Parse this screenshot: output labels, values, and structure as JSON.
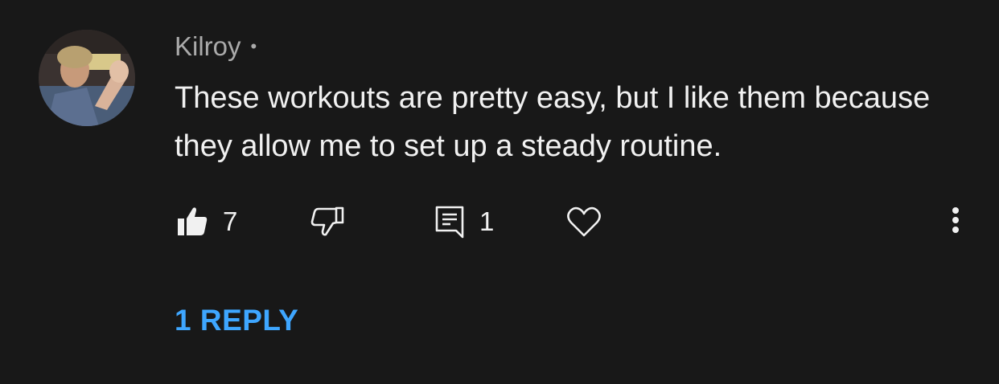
{
  "comment": {
    "author": "Kilroy",
    "separator": "•",
    "text": "These workouts are pretty easy, but I like them because they allow me to set up a steady routine.",
    "like_count": "7",
    "reply_count": "1",
    "replies_link": "1 REPLY"
  },
  "icons": {
    "like": "thumbs-up-filled-icon",
    "dislike": "thumbs-down-outline-icon",
    "reply": "comment-icon",
    "heart": "heart-outline-icon",
    "more": "more-vertical-icon"
  },
  "colors": {
    "background": "#181818",
    "text": "#f1f1f1",
    "secondary_text": "#aaaaaa",
    "link": "#3ea6ff"
  }
}
